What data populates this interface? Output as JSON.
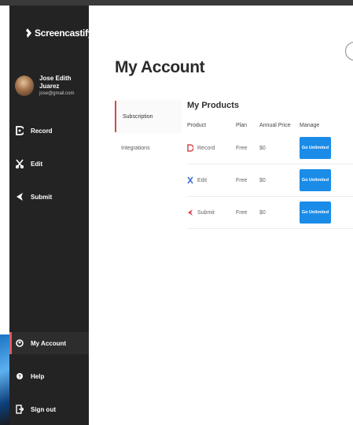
{
  "app": {
    "logo_text": "Screencastify"
  },
  "user": {
    "name": "Jose Edith Juarez",
    "email": "jose@gmail.com"
  },
  "nav": {
    "top": [
      {
        "label": "Record",
        "icon": "record-icon"
      },
      {
        "label": "Edit",
        "icon": "edit-icon"
      },
      {
        "label": "Submit",
        "icon": "submit-icon"
      }
    ],
    "bottom": [
      {
        "label": "My Account",
        "icon": "account-icon",
        "active": true
      },
      {
        "label": "Help",
        "icon": "help-icon"
      },
      {
        "label": "Sign out",
        "icon": "sign-out-icon"
      }
    ]
  },
  "page": {
    "title": "My Account"
  },
  "subnav": {
    "items": [
      {
        "label": "Subscription",
        "active": true
      },
      {
        "label": "Integrations",
        "active": false
      }
    ]
  },
  "products": {
    "title": "My Products",
    "columns": [
      "Product",
      "Plan",
      "Annual Price",
      "Manage"
    ],
    "rows": [
      {
        "product": "Record",
        "plan": "Free",
        "price": "$0",
        "action": "Go Unlimited",
        "icon": "record-icon"
      },
      {
        "product": "Edit",
        "plan": "Free",
        "price": "$0",
        "action": "Go Unlimited",
        "icon": "edit-icon"
      },
      {
        "product": "Submit",
        "plan": "Free",
        "price": "$0",
        "action": "Go Unlimited",
        "icon": "submit-icon"
      }
    ]
  },
  "colors": {
    "sidebar_bg": "#232323",
    "accent_red": "#d44b4b",
    "accent_blue": "#1a8ce8",
    "edit_blue": "#3a6fd8"
  }
}
